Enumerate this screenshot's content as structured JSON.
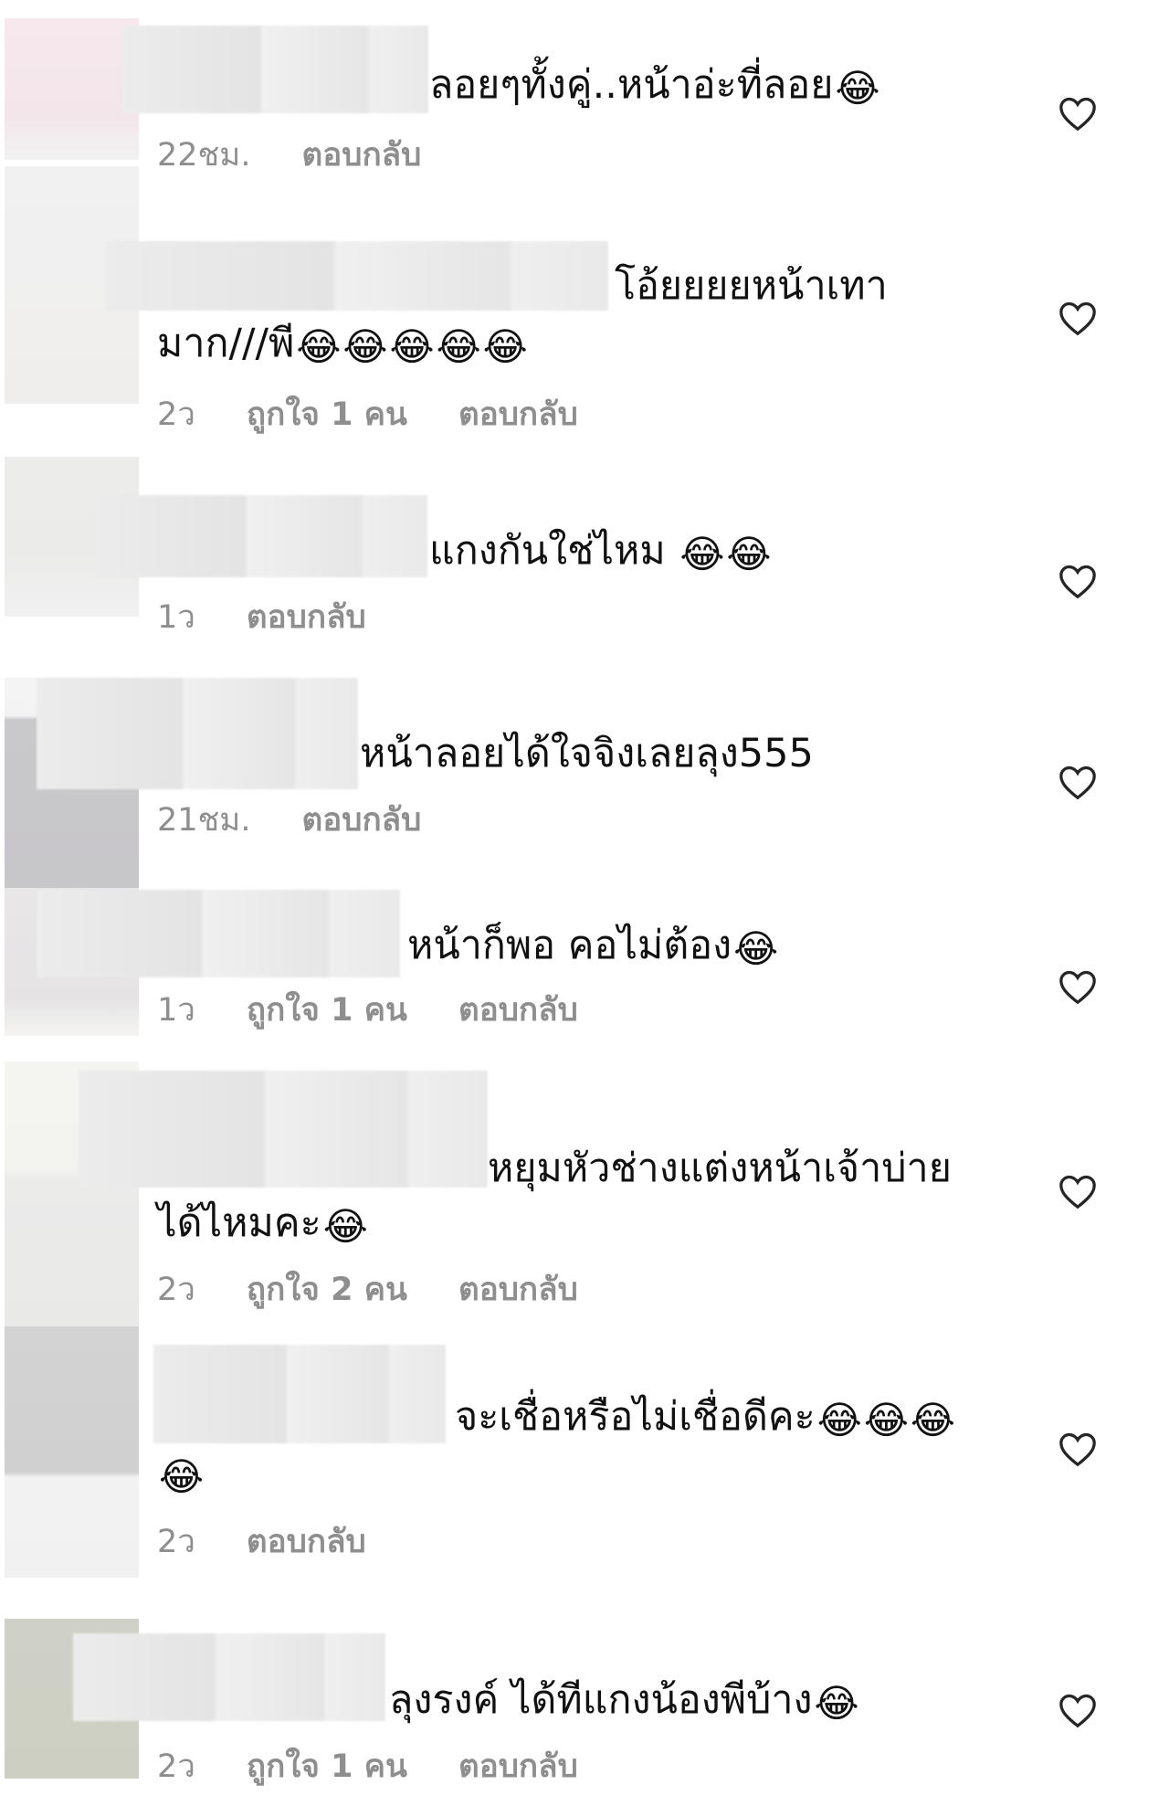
{
  "icons": {
    "emoji": "😂",
    "like": "heart-outline-icon"
  },
  "colors": {
    "meta_text": "#8e8e8e",
    "comment_text": "#111111",
    "heart_stroke": "#262626"
  },
  "comments": [
    {
      "text": "ลอยๆทั้งคู่..หน้าอ่ะที่ลอย",
      "emoji_count": 1,
      "second_line": "",
      "second_emoji_count": 0,
      "time": "22ชม.",
      "likes": "",
      "reply": "ตอบกลับ"
    },
    {
      "text": "โอ้ยยยยหน้าเทา",
      "emoji_count": 0,
      "second_line": "มาก///พี",
      "second_emoji_count": 5,
      "time": "2ว",
      "likes": "ถูกใจ 1 คน",
      "reply": "ตอบกลับ"
    },
    {
      "text": "แกงกันใช่ไหม ",
      "emoji_count": 2,
      "second_line": "",
      "second_emoji_count": 0,
      "time": "1ว",
      "likes": "",
      "reply": "ตอบกลับ"
    },
    {
      "text": "หน้าลอยได้ใจจิงเลยลุง555",
      "emoji_count": 0,
      "second_line": "",
      "second_emoji_count": 0,
      "time": "21ชม.",
      "likes": "",
      "reply": "ตอบกลับ"
    },
    {
      "text": "หน้าก็พอ คอไม่ต้อง",
      "emoji_count": 1,
      "second_line": "",
      "second_emoji_count": 0,
      "time": "1ว",
      "likes": "ถูกใจ 1 คน",
      "reply": "ตอบกลับ"
    },
    {
      "text": "หยุมหัวช่างแต่งหน้าเจ้าบ่าย",
      "emoji_count": 0,
      "second_line": "ได้ไหมคะ",
      "second_emoji_count": 1,
      "time": "2ว",
      "likes": "ถูกใจ 2 คน",
      "reply": "ตอบกลับ"
    },
    {
      "text": "จะเชื่อหรือไม่เชื่อดีคะ",
      "emoji_count": 3,
      "second_line": "",
      "second_emoji_count": 1,
      "time": "2ว",
      "likes": "",
      "reply": "ตอบกลับ"
    },
    {
      "text": "ลุงรงค์ ได้ทีแกงน้องพีบ้าง",
      "emoji_count": 1,
      "second_line": "",
      "second_emoji_count": 0,
      "time": "2ว",
      "likes": "ถูกใจ 1 คน",
      "reply": "ตอบกลับ"
    }
  ]
}
